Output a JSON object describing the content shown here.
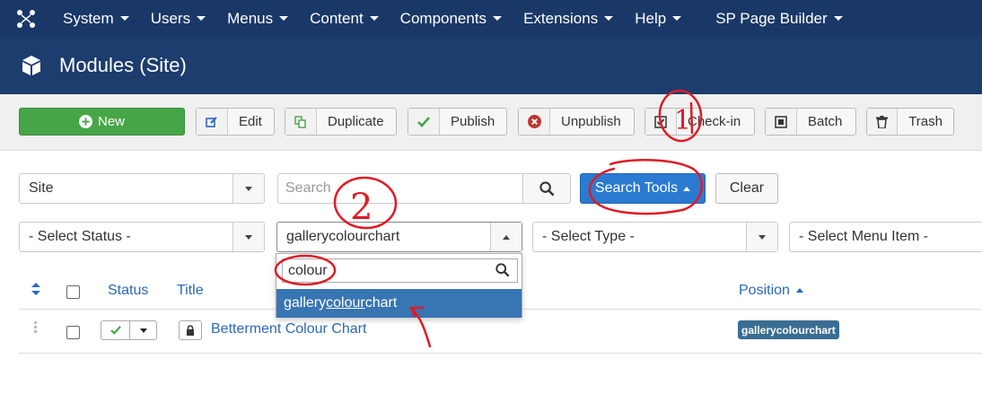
{
  "nav": {
    "items": [
      {
        "label": "System"
      },
      {
        "label": "Users"
      },
      {
        "label": "Menus"
      },
      {
        "label": "Content"
      },
      {
        "label": "Components"
      },
      {
        "label": "Extensions"
      },
      {
        "label": "Help"
      },
      {
        "label": "SP Page Builder"
      }
    ]
  },
  "header": {
    "title": "Modules (Site)"
  },
  "toolbar": {
    "new_label": "New",
    "edit_label": "Edit",
    "duplicate_label": "Duplicate",
    "publish_label": "Publish",
    "unpublish_label": "Unpublish",
    "checkin_label": "Check-in",
    "batch_label": "Batch",
    "trash_label": "Trash"
  },
  "filters": {
    "client_value": "Site",
    "search_placeholder": "Search",
    "search_tools_label": "Search Tools",
    "clear_label": "Clear",
    "status_value": "- Select Status -",
    "position_value": "gallerycolourchart",
    "type_value": "- Select Type -",
    "menu_item_value": "- Select Menu Item -"
  },
  "position_dropdown": {
    "search_value": "colour",
    "option_prefix": "gallery",
    "option_match": "colour",
    "option_suffix": "chart"
  },
  "table": {
    "headers": {
      "status": "Status",
      "title": "Title",
      "position": "Position"
    },
    "rows": [
      {
        "title": "Betterment Colour Chart",
        "position": "gallerycolourchart"
      }
    ]
  },
  "annotations": {
    "mark1": "1",
    "mark2": "2"
  },
  "colors": {
    "nav_bg": "#1a3867",
    "header_bg": "#1c3d6e",
    "new_button": "#46a546",
    "search_tools": "#2a7ad2",
    "selected_option": "#3875b3",
    "link": "#2a69b8",
    "badge": "#3a6d92",
    "annotation": "#e01b24"
  }
}
